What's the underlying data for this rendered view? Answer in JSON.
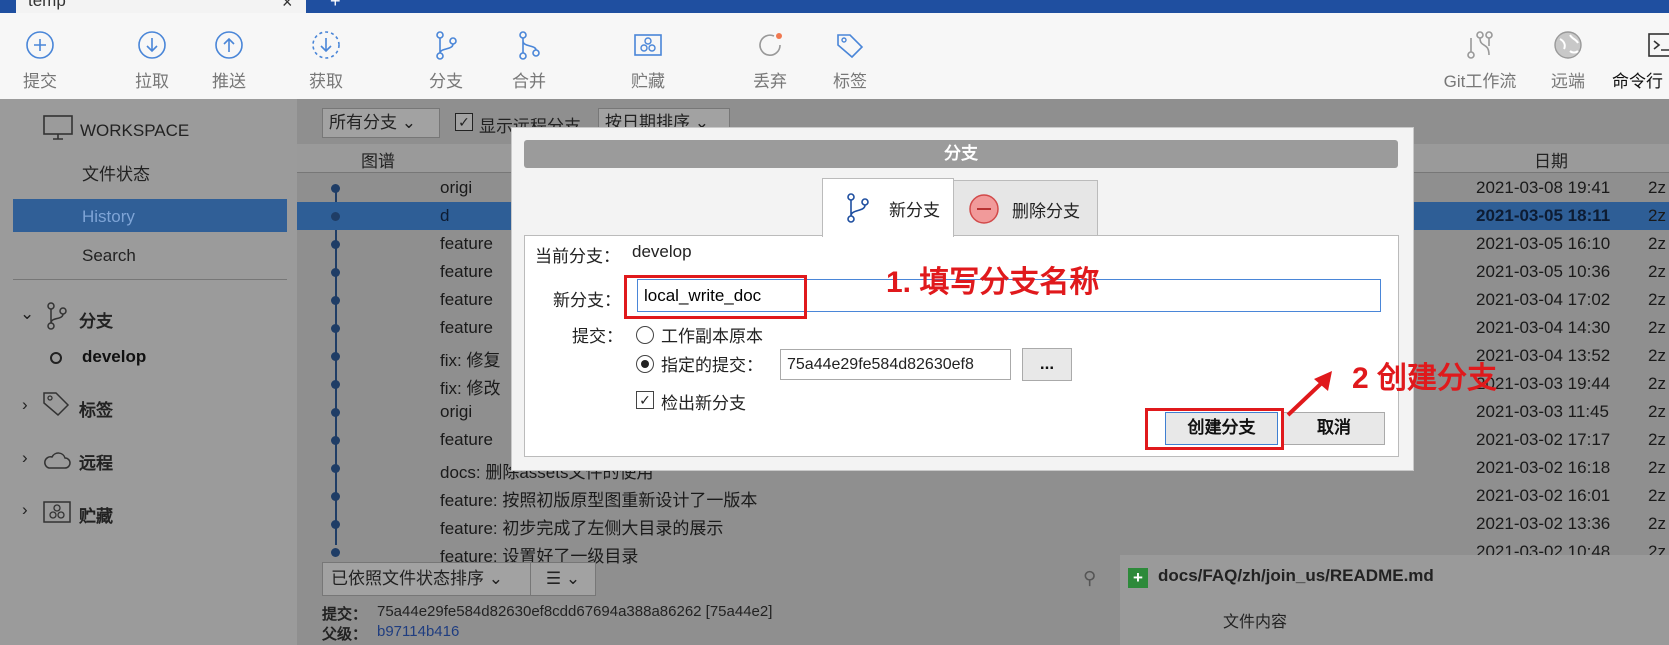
{
  "window": {
    "tab_label": "temp",
    "close_glyph": "×",
    "add_glyph": "+"
  },
  "toolbar": {
    "items": [
      {
        "label": "提交",
        "icon": "commit-icon"
      },
      {
        "label": "拉取",
        "icon": "pull-icon"
      },
      {
        "label": "推送",
        "icon": "push-icon"
      },
      {
        "label": "获取",
        "icon": "fetch-icon"
      },
      {
        "label": "分支",
        "icon": "branch-icon"
      },
      {
        "label": "合并",
        "icon": "merge-icon"
      },
      {
        "label": "贮藏",
        "icon": "stash-icon"
      },
      {
        "label": "丢弃",
        "icon": "discard-icon"
      },
      {
        "label": "标签",
        "icon": "tag-icon"
      },
      {
        "label": "Git工作流",
        "icon": "git-flow-icon"
      },
      {
        "label": "远端",
        "icon": "remote-icon"
      },
      {
        "label": "命令行",
        "icon": "terminal-icon"
      }
    ]
  },
  "sidebar": {
    "workspace": "WORKSPACE",
    "items": [
      "文件状态",
      "History",
      "Search"
    ],
    "branches_header": "分支",
    "branch": "develop",
    "tags_header": "标签",
    "remotes_header": "远程",
    "stash_header": "贮藏"
  },
  "history": {
    "filter_branch": "所有分支",
    "show_remote": "显示远程分支",
    "sort": "按日期排序",
    "col_graph": "图谱",
    "col_date": "日期",
    "rows": [
      {
        "text": "origi",
        "date": "2021-03-08 19:41",
        "z": "2z"
      },
      {
        "text": "d",
        "date": "2021-03-05 18:11",
        "z": "2z"
      },
      {
        "text": "feature",
        "date": "2021-03-05 16:10",
        "z": "2z"
      },
      {
        "text": "feature",
        "date": "2021-03-05 10:36",
        "z": "2z"
      },
      {
        "text": "feature",
        "date": "2021-03-04 17:02",
        "z": "2z"
      },
      {
        "text": "feature",
        "date": "2021-03-04 14:30",
        "z": "2z"
      },
      {
        "text": "fix: 修复",
        "date": "2021-03-04 13:52",
        "z": "2z"
      },
      {
        "text": "fix: 修改",
        "date": "2021-03-03 19:44",
        "z": "2z"
      },
      {
        "text": "origi",
        "date": "2021-03-03 11:45",
        "z": "2z"
      },
      {
        "text": "feature",
        "date": "2021-03-02 17:17",
        "z": "2z"
      },
      {
        "text": "docs: 删除assets文件的使用",
        "date": "2021-03-02 16:18",
        "z": "2z"
      },
      {
        "text": "feature: 按照初版原型图重新设计了一版本",
        "date": "2021-03-02 16:01",
        "z": "2z"
      },
      {
        "text": "feature: 初步完成了左侧大目录的展示",
        "date": "2021-03-02 13:36",
        "z": "2z"
      },
      {
        "text": "feature: 设置好了一级目录",
        "date": "2021-03-02 10:48",
        "z": "2z"
      }
    ]
  },
  "bottom": {
    "sort_select": "已依照文件状态排序",
    "list_glyph": "☰",
    "file_path": "docs/FAQ/zh/join_us/README.md",
    "file_content_header": "文件内容",
    "commit_label": "提交：",
    "commit_value": "75a44e29fe584d82630ef8cdd67694a388a86262 [75a44e2]",
    "parent_label": "父级：",
    "parent_value": "b97114b416"
  },
  "dialog": {
    "title": "分支",
    "tab_new": "新分支",
    "tab_delete": "删除分支",
    "current_branch_label": "当前分支：",
    "current_branch_value": "develop",
    "new_branch_label": "新分支：",
    "new_branch_value": "local_write_doc",
    "commit_label": "提交：",
    "radio_working_copy": "工作副本原本",
    "radio_specified": "指定的提交：",
    "specified_commit": "75a44e29fe584d82630ef8",
    "browse_label": "...",
    "checkout_label": "检出新分支",
    "create_button": "创建分支",
    "cancel_button": "取消"
  },
  "annotations": {
    "step1": "1. 填写分支名称",
    "step2": "2 创建分支",
    "color": "#e0191c"
  }
}
